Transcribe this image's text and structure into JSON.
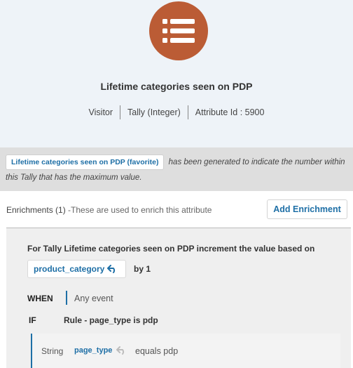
{
  "attribute": {
    "title": "Lifetime categories seen on PDP",
    "meta": [
      "Visitor",
      "Tally (Integer)",
      "Attribute Id : 5900"
    ]
  },
  "notice": {
    "tag_label": "Lifetime categories seen on PDP (favorite)",
    "text": "has been generated to indicate the number within this Tally that has the maximum value."
  },
  "enrichments": {
    "label": "Enrichments (1)",
    "description": " -These are used to enrich this attribute",
    "add_label": "Add Enrichment"
  },
  "rule": {
    "title": "For Tally Lifetime categories seen on PDP increment the value based on",
    "field_chip": "product_category",
    "by_text": "by 1",
    "when_label": "WHEN",
    "when_value": "Any event",
    "if_label": "IF",
    "if_value": "Rule - page_type is pdp",
    "condition": {
      "type": "String",
      "field": "page_type",
      "operator": "equals pdp"
    }
  },
  "colors": {
    "accent": "#1e6fa6",
    "icon_circle": "#bb5c35",
    "header_bg": "#eef3f8",
    "notice_bg": "#dedede"
  },
  "icons": {
    "header": "list-icon",
    "chip": "undo-arrow-icon"
  }
}
